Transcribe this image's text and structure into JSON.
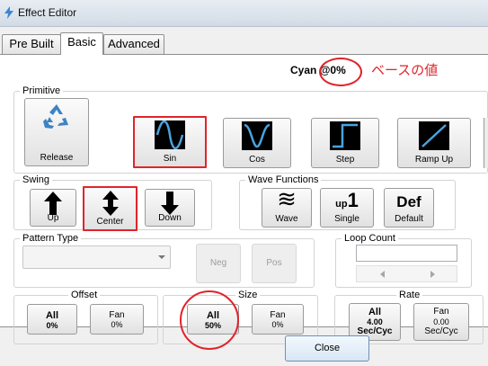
{
  "window": {
    "title": "Effect Editor"
  },
  "tabs": [
    {
      "label": "Pre Built"
    },
    {
      "label": "Basic"
    },
    {
      "label": "Advanced"
    }
  ],
  "status": {
    "color_name": "Cyan",
    "value": "@0%"
  },
  "annotation": {
    "text": "ベースの値",
    "color": "#e0242b"
  },
  "primitive": {
    "label": "Primitive",
    "buttons": [
      {
        "label": "Release",
        "icon": "recycle-icon"
      },
      {
        "label": "Sin",
        "icon": "sine-wave-icon",
        "selected": true
      },
      {
        "label": "Cos",
        "icon": "cosine-wave-icon"
      },
      {
        "label": "Step",
        "icon": "step-wave-icon"
      },
      {
        "label": "Ramp Up",
        "icon": "ramp-up-icon"
      }
    ]
  },
  "swing": {
    "label": "Swing",
    "buttons": [
      {
        "label": "Up",
        "icon": "arrow-up-icon"
      },
      {
        "label": "Center",
        "icon": "arrow-updown-icon",
        "selected": true
      },
      {
        "label": "Down",
        "icon": "arrow-down-icon"
      }
    ]
  },
  "wave_functions": {
    "label": "Wave Functions",
    "buttons": [
      {
        "label": "Wave",
        "icon": "wave-icon",
        "glyph": "≋"
      },
      {
        "label": "Single",
        "icon": "up-one-icon",
        "glyph_small": "up",
        "glyph_big": "1"
      },
      {
        "label": "Default",
        "icon": "default-icon",
        "glyph": "Def"
      }
    ]
  },
  "pattern_type": {
    "label": "Pattern Type",
    "value": "",
    "neg_label": "Neg",
    "pos_label": "Pos"
  },
  "loop_count": {
    "label": "Loop Count",
    "value": ""
  },
  "offset": {
    "label": "Offset",
    "all": {
      "line1": "All",
      "line2": "0%"
    },
    "fan": {
      "line1": "Fan",
      "line2": "0%"
    }
  },
  "size": {
    "label": "Size",
    "all": {
      "line1": "All",
      "line2": "50%"
    },
    "fan": {
      "line1": "Fan",
      "line2": "0%"
    }
  },
  "rate": {
    "label": "Rate",
    "all": {
      "line1": "All",
      "line2": "4.00",
      "line3": "Sec/Cyc"
    },
    "fan": {
      "line1": "Fan",
      "line2": "0.00",
      "line3": "Sec/Cyc"
    }
  },
  "footer": {
    "close_label": "Close"
  },
  "colors": {
    "accent_red": "#e0242b",
    "icon_blue": "#4aa3df",
    "panel_bg": "#ffffff"
  }
}
